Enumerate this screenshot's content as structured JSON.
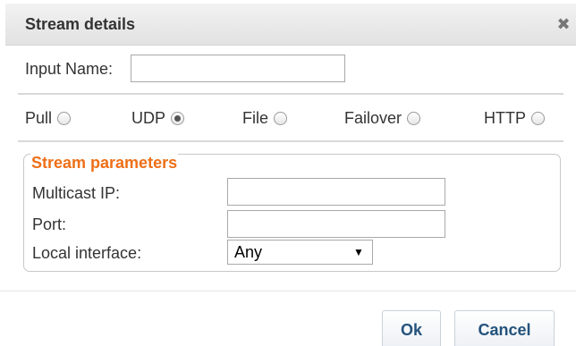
{
  "dialog": {
    "title": "Stream details",
    "close_icon": "close-icon (×)"
  },
  "input_name": {
    "label": "Input Name:",
    "value": ""
  },
  "stream_type": {
    "selected": "UDP",
    "options": [
      {
        "label": "Pull",
        "checked": false
      },
      {
        "label": "UDP",
        "checked": true
      },
      {
        "label": "File",
        "checked": false
      },
      {
        "label": "Failover",
        "checked": false
      },
      {
        "label": "HTTP",
        "checked": false
      }
    ]
  },
  "stream_parameters": {
    "legend": "Stream parameters",
    "multicast_ip_label": "Multicast IP:",
    "multicast_ip_value": "",
    "port_label": "Port:",
    "port_value": "",
    "local_interface_label": "Local interface:",
    "local_interface_value": "Any"
  },
  "buttons": {
    "ok_label": "Ok",
    "cancel_label": "Cancel"
  },
  "colors": {
    "legend": "#ee6f18",
    "button_text": "#23527c",
    "titlebar": "#e8e8e8"
  }
}
